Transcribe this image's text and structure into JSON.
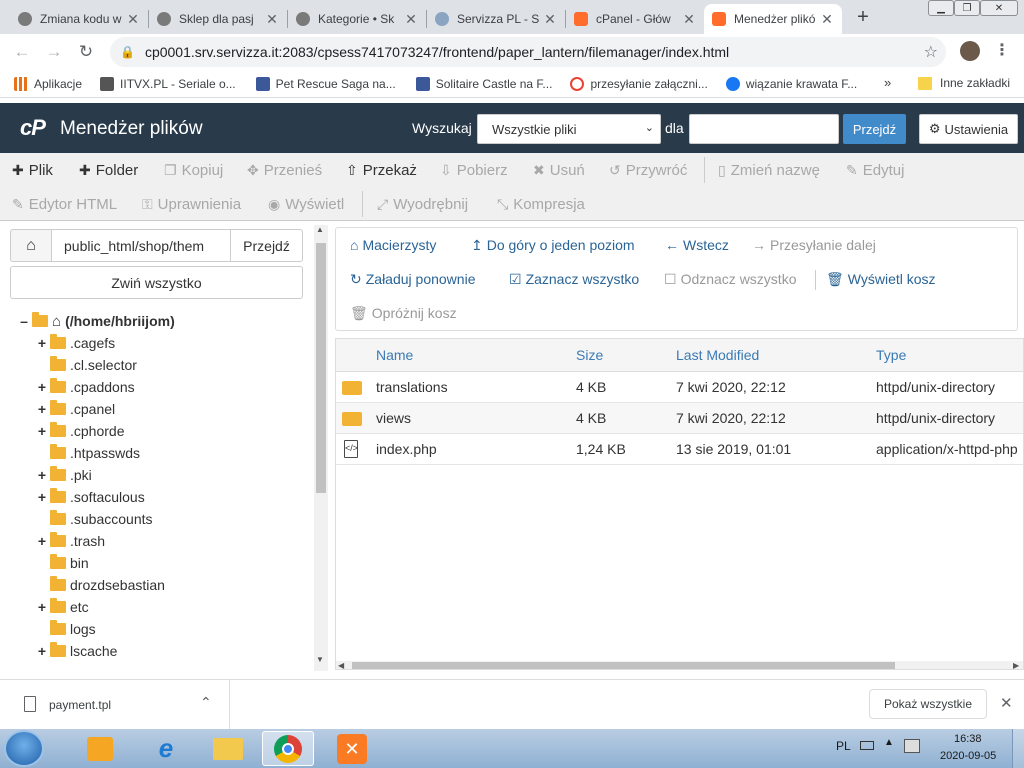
{
  "browser": {
    "tabs": [
      {
        "label": "Zmiana kodu w",
        "fav_color": "#7a7a7a"
      },
      {
        "label": "Sklep dla pasj",
        "fav_color": "#7a7a7a"
      },
      {
        "label": "Kategorie • Sk",
        "fav_color": "#7a7a7a"
      },
      {
        "label": "Servizza PL - S",
        "fav_color": "#8aa4c2"
      },
      {
        "label": "cPanel - Głów",
        "fav_color": "#ff6c2c"
      },
      {
        "label": "Menedżer plikó",
        "fav_color": "#ff6c2c"
      }
    ],
    "new_tab": "+",
    "url": "cp0001.srv.servizza.it:2083/cpsess7417073247/frontend/paper_lantern/filemanager/index.html",
    "bookmarks": [
      {
        "label": "Aplikacje",
        "color": "#e8711c"
      },
      {
        "label": "IITVX.PL - Seriale o...",
        "color": "#555555"
      },
      {
        "label": "Pet Rescue Saga na...",
        "color": "#3b5998"
      },
      {
        "label": "Solitaire Castle na F...",
        "color": "#3b5998"
      },
      {
        "label": "przesyłanie załączni...",
        "color": "#ea4335"
      },
      {
        "label": "wiązanie krawata  F...",
        "color": "#1877f2"
      }
    ],
    "bookmarks_more": "»",
    "other_bookmarks": "Inne zakładki"
  },
  "header": {
    "logo": "cP",
    "title": "Menedżer plików",
    "search_label": "Wyszukaj",
    "search_scope": "Wszystkie pliki",
    "for_label": "dla",
    "search_placeholder": "",
    "go_button": "Przejdź",
    "settings_button": "Ustawienia"
  },
  "toolbar": {
    "file": "Plik",
    "folder": "Folder",
    "copy": "Kopiuj",
    "move": "Przenieś",
    "upload": "Przekaż",
    "download": "Pobierz",
    "delete": "Usuń",
    "restore": "Przywróć",
    "rename": "Zmień nazwę",
    "edit": "Edytuj",
    "html_editor": "Edytor HTML",
    "permissions": "Uprawnienia",
    "view": "Wyświetl",
    "extract": "Wyodrębnij",
    "compress": "Kompresja"
  },
  "sidebar": {
    "path": "public_html/shop/them",
    "go_button": "Przejdź",
    "collapse_all": "Zwiń wszystko",
    "root": "(/home/hbriijom)",
    "items": [
      {
        "name": ".cagefs",
        "expandable": true
      },
      {
        "name": ".cl.selector",
        "expandable": false
      },
      {
        "name": ".cpaddons",
        "expandable": true
      },
      {
        "name": ".cpanel",
        "expandable": true
      },
      {
        "name": ".cphorde",
        "expandable": true
      },
      {
        "name": ".htpasswds",
        "expandable": false
      },
      {
        "name": ".pki",
        "expandable": true
      },
      {
        "name": ".softaculous",
        "expandable": true
      },
      {
        "name": ".subaccounts",
        "expandable": false
      },
      {
        "name": ".trash",
        "expandable": true
      },
      {
        "name": "bin",
        "expandable": false
      },
      {
        "name": "drozdsebastian",
        "expandable": false
      },
      {
        "name": "etc",
        "expandable": true
      },
      {
        "name": "logs",
        "expandable": false
      },
      {
        "name": "lscache",
        "expandable": true
      }
    ]
  },
  "actions": {
    "home": "Macierzysty",
    "up": "Do góry o jeden poziom",
    "back": "Wstecz",
    "forward": "Przesyłanie dalej",
    "reload": "Załaduj ponownie",
    "select_all": "Zaznacz wszystko",
    "deselect_all": "Odznacz wszystko",
    "view_trash": "Wyświetl kosz",
    "empty_trash": "Opróżnij kosz"
  },
  "table": {
    "columns": [
      "Name",
      "Size",
      "Last Modified",
      "Type"
    ],
    "rows": [
      {
        "name": "translations",
        "size": "4 KB",
        "modified": "7 kwi 2020, 22:12",
        "type": "httpd/unix-directory",
        "kind": "folder"
      },
      {
        "name": "views",
        "size": "4 KB",
        "modified": "7 kwi 2020, 22:12",
        "type": "httpd/unix-directory",
        "kind": "folder"
      },
      {
        "name": "index.php",
        "size": "1,24 KB",
        "modified": "13 sie 2019, 01:01",
        "type": "application/x-httpd-php",
        "kind": "file"
      }
    ]
  },
  "downloads": {
    "file": "payment.tpl",
    "show_all": "Pokaż wszystkie"
  },
  "taskbar": {
    "language": "PL",
    "time": "16:38",
    "date": "2020-09-05"
  },
  "colors": {
    "cpanel_header": "#293a4a",
    "link_blue": "#2a6496",
    "button_blue": "#428bca",
    "folder": "#f2b233"
  }
}
